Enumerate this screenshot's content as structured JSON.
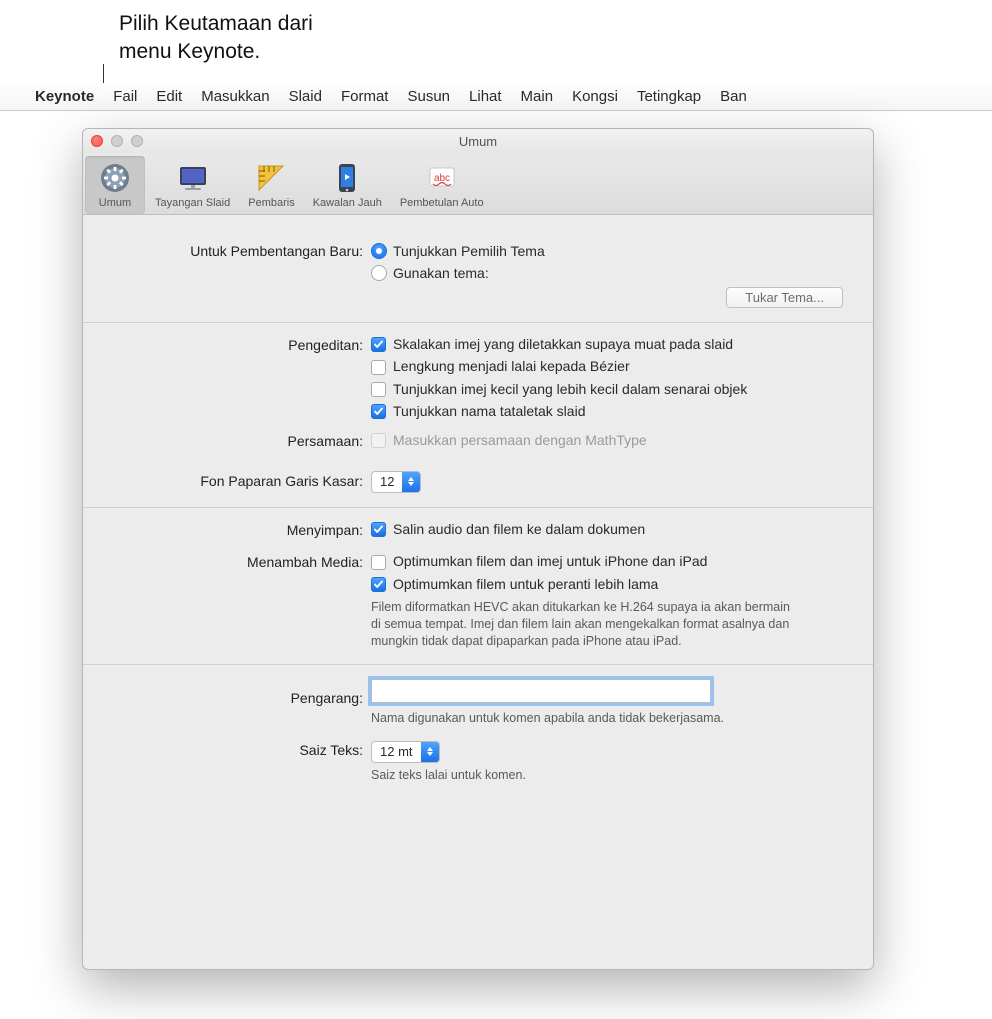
{
  "callout": {
    "line1": "Pilih Keutamaan dari",
    "line2": "menu Keynote."
  },
  "menubar": {
    "app": "Keynote",
    "items": [
      "Fail",
      "Edit",
      "Masukkan",
      "Slaid",
      "Format",
      "Susun",
      "Lihat",
      "Main",
      "Kongsi",
      "Tetingkap",
      "Ban"
    ]
  },
  "window": {
    "title": "Umum"
  },
  "toolbar": {
    "umum": "Umum",
    "tayangan": "Tayangan Slaid",
    "pembaris": "Pembaris",
    "kawalan": "Kawalan Jauh",
    "pembetulan": "Pembetulan Auto"
  },
  "sections": {
    "pembentangan": {
      "label": "Untuk Pembentangan Baru:",
      "opt_show_picker": "Tunjukkan Pemilih Tema",
      "opt_use_theme": "Gunakan tema:",
      "change_theme_btn": "Tukar Tema..."
    },
    "pengeditan": {
      "label": "Pengeditan:",
      "scale_images": "Skalakan imej yang diletakkan supaya muat pada slaid",
      "curves_bezier": "Lengkung menjadi lalai kepada Bézier",
      "small_thumbs": "Tunjukkan imej kecil yang lebih kecil dalam senarai objek",
      "show_layout": "Tunjukkan nama tataletak slaid"
    },
    "persamaan": {
      "label": "Persamaan:",
      "mathtype": "Masukkan persamaan dengan MathType"
    },
    "fon": {
      "label": "Fon Paparan Garis Kasar:",
      "value": "12"
    },
    "menyimpan": {
      "label": "Menyimpan:",
      "copy_media": "Salin audio dan filem ke dalam dokumen"
    },
    "menambah": {
      "label": "Menambah Media:",
      "opt_iphone": "Optimumkan filem dan imej untuk iPhone dan iPad",
      "opt_older": "Optimumkan filem untuk peranti lebih lama",
      "help": "Filem diformatkan HEVC akan ditukarkan ke H.264 supaya ia akan bermain di semua tempat. Imej dan filem lain akan mengekalkan format asalnya dan mungkin tidak dapat dipaparkan pada iPhone atau iPad."
    },
    "pengarang": {
      "label": "Pengarang:",
      "value": "",
      "help": "Nama digunakan untuk komen apabila anda tidak bekerjasama."
    },
    "saiz": {
      "label": "Saiz Teks:",
      "value": "12 mt",
      "help": "Saiz teks lalai untuk komen."
    }
  }
}
